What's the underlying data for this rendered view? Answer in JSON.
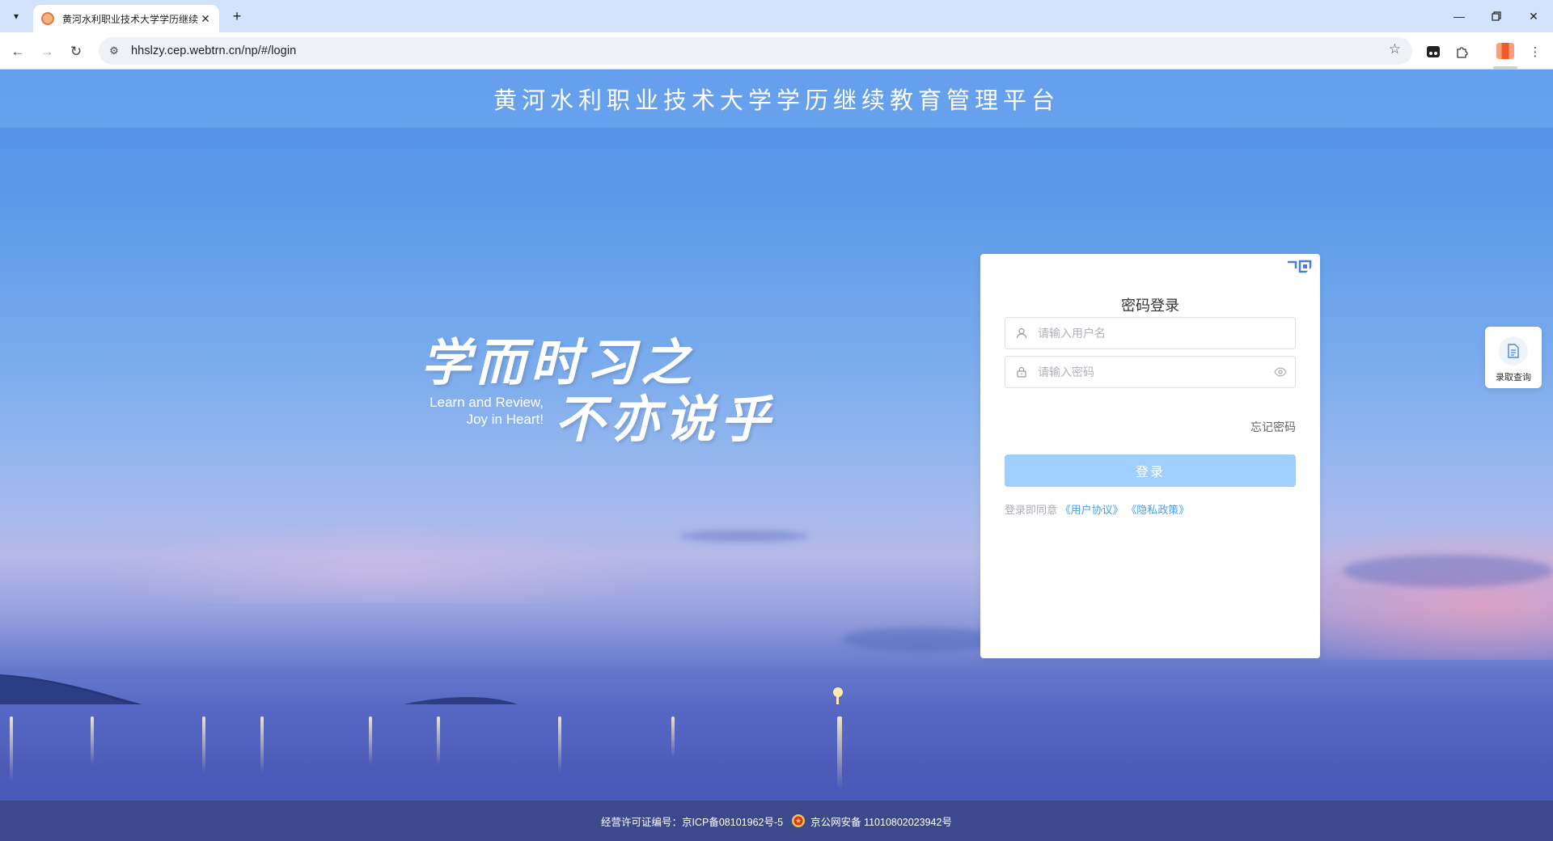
{
  "browser": {
    "tab_title": "黄河水利职业技术大学学历继续",
    "url": "hhslzy.cep.webtrn.cn/np/#/login"
  },
  "page": {
    "site_title": "黄河水利职业技术大学学历继续教育管理平台",
    "slogan_cn_line1": "学而时习之",
    "slogan_cn_line2": "不亦说乎",
    "slogan_en_line1": "Learn and Review,",
    "slogan_en_line2": "Joy in Heart!"
  },
  "login": {
    "title": "密码登录",
    "username_placeholder": "请输入用户名",
    "password_placeholder": "请输入密码",
    "forgot_password": "忘记密码",
    "login_button": "登录",
    "agree_prefix": "登录即同意",
    "user_agreement": "《用户协议》",
    "privacy_policy": "《隐私政策》"
  },
  "side_float": {
    "label": "录取查询"
  },
  "footer": {
    "license": "经营许可证编号：京ICP备08101962号-5",
    "police_record": "京公网安备 11010802023942号"
  },
  "colors": {
    "primary": "#409eff",
    "button_disabled": "#a0cfff",
    "footer_bg": "#3c4a8c"
  }
}
